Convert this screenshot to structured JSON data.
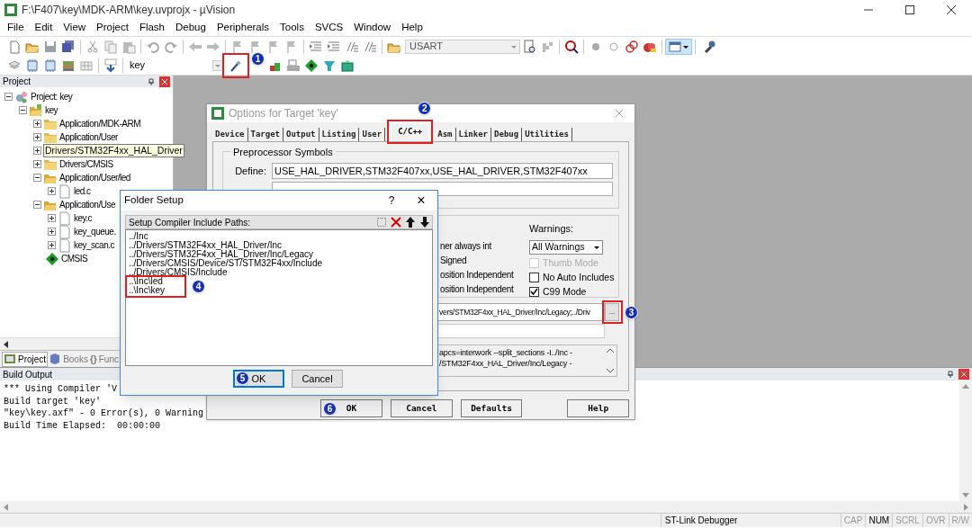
{
  "window": {
    "title": "F:\\F407\\key\\MDK-ARM\\key.uvprojx - µVision"
  },
  "menu": [
    "File",
    "Edit",
    "View",
    "Project",
    "Flash",
    "Debug",
    "Peripherals",
    "Tools",
    "SVCS",
    "Window",
    "Help"
  ],
  "toolbar": {
    "file_combo": "USART",
    "target_combo": "key"
  },
  "project_panel": {
    "title": "Project",
    "tree": [
      {
        "label": "Project: key",
        "kind": "root",
        "expanded": true,
        "children": [
          {
            "label": "key",
            "kind": "target",
            "expanded": true,
            "children": [
              {
                "label": "Application/MDK-ARM",
                "kind": "group",
                "expanded": false
              },
              {
                "label": "Application/User",
                "kind": "group",
                "expanded": false
              },
              {
                "tooltip": "Drivers/STM32F4xx_HAL_Driver",
                "kind": "group",
                "expanded": false
              },
              {
                "label": "Drivers/CMSIS",
                "kind": "group",
                "expanded": false
              },
              {
                "label": "Application/User/led",
                "kind": "group",
                "expanded": true,
                "children": [
                  {
                    "label": "led.c",
                    "kind": "file",
                    "expanded": false
                  }
                ]
              },
              {
                "label": "Application/Use",
                "kind": "group",
                "expanded": true,
                "children": [
                  {
                    "label": "key.c",
                    "kind": "file",
                    "expanded": false
                  },
                  {
                    "label": "key_queue.",
                    "kind": "file",
                    "expanded": false
                  },
                  {
                    "label": "key_scan.c",
                    "kind": "file",
                    "expanded": false
                  }
                ]
              },
              {
                "label": "CMSIS",
                "kind": "component"
              }
            ]
          }
        ]
      }
    ],
    "tabs": [
      {
        "label": "Project",
        "selected": true
      },
      {
        "label": "Books",
        "selected": false
      },
      {
        "icon": "{}",
        "label": "Func",
        "selected": false
      }
    ]
  },
  "build_output": {
    "title": "Build Output",
    "lines": [
      "*** Using Compiler 'V",
      "Build target 'key'",
      "\"key\\key.axf\" - 0 Error(s), 0 Warning",
      "Build Time Elapsed:  00:00:00"
    ]
  },
  "status_bar": {
    "debugger": "ST-Link Debugger",
    "indicators": [
      {
        "label": "CAP",
        "on": false
      },
      {
        "label": "NUM",
        "on": true
      },
      {
        "label": "SCRL",
        "on": false
      },
      {
        "label": "OVR",
        "on": false
      },
      {
        "label": "R/W",
        "on": false
      }
    ]
  },
  "options_dialog": {
    "title": "Options for Target 'key'",
    "tabs": [
      {
        "label": "Device",
        "selected": false
      },
      {
        "label": "Target",
        "selected": false
      },
      {
        "label": "Output",
        "selected": false
      },
      {
        "label": "Listing",
        "selected": false
      },
      {
        "label": "User",
        "selected": false
      },
      {
        "label": "C/C++",
        "selected": true
      },
      {
        "label": "Asm",
        "selected": false
      },
      {
        "label": "Linker",
        "selected": false
      },
      {
        "label": "Debug",
        "selected": false
      },
      {
        "label": "Utilities",
        "selected": false
      }
    ],
    "preprocessor": {
      "title": "Preprocessor Symbols",
      "define_label": "Define:",
      "define": "USE_HAL_DRIVER,STM32F407xx,USE_HAL_DRIVER,STM32F407xx"
    },
    "code_options": [
      "ner always int",
      "Signed",
      "osition Independent",
      "osition Independent"
    ],
    "warnings": {
      "label": "Warnings:",
      "value": "All Warnings"
    },
    "checkboxes": [
      {
        "label": "Thumb Mode",
        "checked": false,
        "disabled": true
      },
      {
        "label": "No Auto Includes",
        "checked": false,
        "disabled": false
      },
      {
        "label": "C99 Mode",
        "checked": true,
        "disabled": false
      }
    ],
    "include_paths": "vers/STM32F4xx_HAL_Driver/Inc/Legacy;../Driv",
    "browse_button": "...",
    "compiler_control": [
      "apcs=interwork --split_sections -I../Inc -",
      "/STM32F4xx_HAL_Driver/Inc/Legacy -"
    ],
    "buttons": [
      "OK",
      "Cancel",
      "Defaults",
      "Help"
    ]
  },
  "folder_dialog": {
    "title": "Folder Setup",
    "help": "?",
    "close": "×",
    "header": "Setup Compiler Include Paths:",
    "paths": [
      "../Inc",
      "../Drivers/STM32F4xx_HAL_Driver/Inc",
      "../Drivers/STM32F4xx_HAL_Driver/Inc/Legacy",
      "../Drivers/CMSIS/Device/ST/STM32F4xx/Include",
      "../Drivers/CMSIS/Include",
      "..\\Inc\\led",
      "..\\Inc\\key"
    ],
    "buttons": [
      "OK",
      "Cancel"
    ]
  },
  "annotations": [
    {
      "number": "1"
    },
    {
      "number": "2"
    },
    {
      "number": "3"
    },
    {
      "number": "4"
    },
    {
      "number": "5"
    },
    {
      "number": "6"
    }
  ]
}
